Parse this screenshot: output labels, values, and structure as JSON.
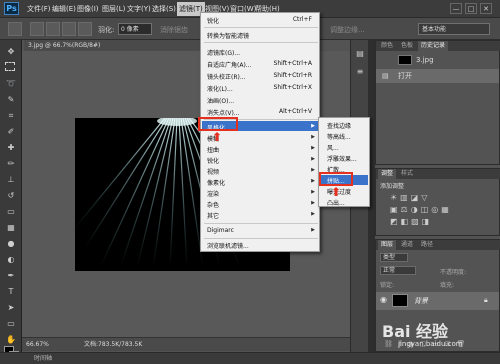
{
  "app": {
    "logo": "Ps"
  },
  "menubar": {
    "items": [
      "文件(F)",
      "编辑(E)",
      "图像(I)",
      "图层(L)",
      "文字(Y)",
      "选择(S)",
      "滤镜(T)",
      "视图(V)",
      "窗口(W)",
      "帮助(H)"
    ],
    "window_buttons": [
      "—",
      "□",
      "✕"
    ]
  },
  "options": {
    "feather_label": "羽化:",
    "feather_value": "0 像素",
    "antialias_label": "消除锯齿",
    "style_label": "样式:",
    "style_value": "正常",
    "width_label": "宽度:",
    "height_label": "高度:",
    "refine_button": "调整边缘...",
    "workspace": "基本功能"
  },
  "document": {
    "tab": "3.jpg @ 66.7%(RGB/8#)",
    "zoom": "66.67%",
    "doc_info": "文档:783.5K/783.5K"
  },
  "bottom": {
    "label": "时间轴"
  },
  "filter_menu": {
    "items": [
      {
        "label": "锐化",
        "shortcut": "Ctrl+F",
        "disabled": false
      },
      {
        "label": "转换为智能滤镜",
        "shortcut": "",
        "disabled": false
      },
      {
        "label": "滤镜库(G)...",
        "shortcut": "",
        "disabled": false
      },
      {
        "label": "自适应广角(A)...",
        "shortcut": "Shift+Ctrl+A",
        "disabled": false
      },
      {
        "label": "镜头校正(R)...",
        "shortcut": "Shift+Ctrl+R",
        "disabled": false
      },
      {
        "label": "液化(L)...",
        "shortcut": "Shift+Ctrl+X",
        "disabled": false
      },
      {
        "label": "油画(O)...",
        "shortcut": "",
        "disabled": false
      },
      {
        "label": "消失点(V)...",
        "shortcut": "Alt+Ctrl+V",
        "disabled": false
      },
      {
        "label": "风格化",
        "shortcut": "",
        "disabled": false
      },
      {
        "label": "模糊",
        "shortcut": "",
        "disabled": false
      },
      {
        "label": "扭曲",
        "shortcut": "",
        "disabled": false
      },
      {
        "label": "锐化",
        "shortcut": "",
        "disabled": false
      },
      {
        "label": "视频",
        "shortcut": "",
        "disabled": false
      },
      {
        "label": "像素化",
        "shortcut": "",
        "disabled": false
      },
      {
        "label": "渲染",
        "shortcut": "",
        "disabled": false
      },
      {
        "label": "杂色",
        "shortcut": "",
        "disabled": false
      },
      {
        "label": "其它",
        "shortcut": "",
        "disabled": false
      },
      {
        "label": "Digimarc",
        "shortcut": "",
        "disabled": false
      },
      {
        "label": "浏览联机滤镜...",
        "shortcut": "",
        "disabled": false
      }
    ]
  },
  "stylize_submenu": {
    "items": [
      "查找边缘",
      "等高线...",
      "风...",
      "浮雕效果...",
      "扩散...",
      "拼贴...",
      "曝光过度",
      "凸出..."
    ]
  },
  "history_panel": {
    "tabs": [
      "颜色",
      "色板",
      "历史记录"
    ],
    "snapshot": "3.jpg",
    "rows": [
      "打开"
    ]
  },
  "adjust_panel": {
    "tabs": [
      "调整",
      "样式"
    ],
    "title": "添加调整"
  },
  "layers_panel": {
    "tabs": [
      "图层",
      "通道",
      "路径"
    ],
    "kind_label": "类型",
    "blend_mode": "正常",
    "opacity_label": "不透明度:",
    "lock_label": "锁定:",
    "fill_label": "填充:",
    "layer_name": "背景"
  },
  "watermark": {
    "brand": "Bai 经验",
    "url": "jingyan.baidu.com"
  },
  "colors": {
    "highlight": "#3a73c9",
    "annotation_red": "#e53020"
  }
}
